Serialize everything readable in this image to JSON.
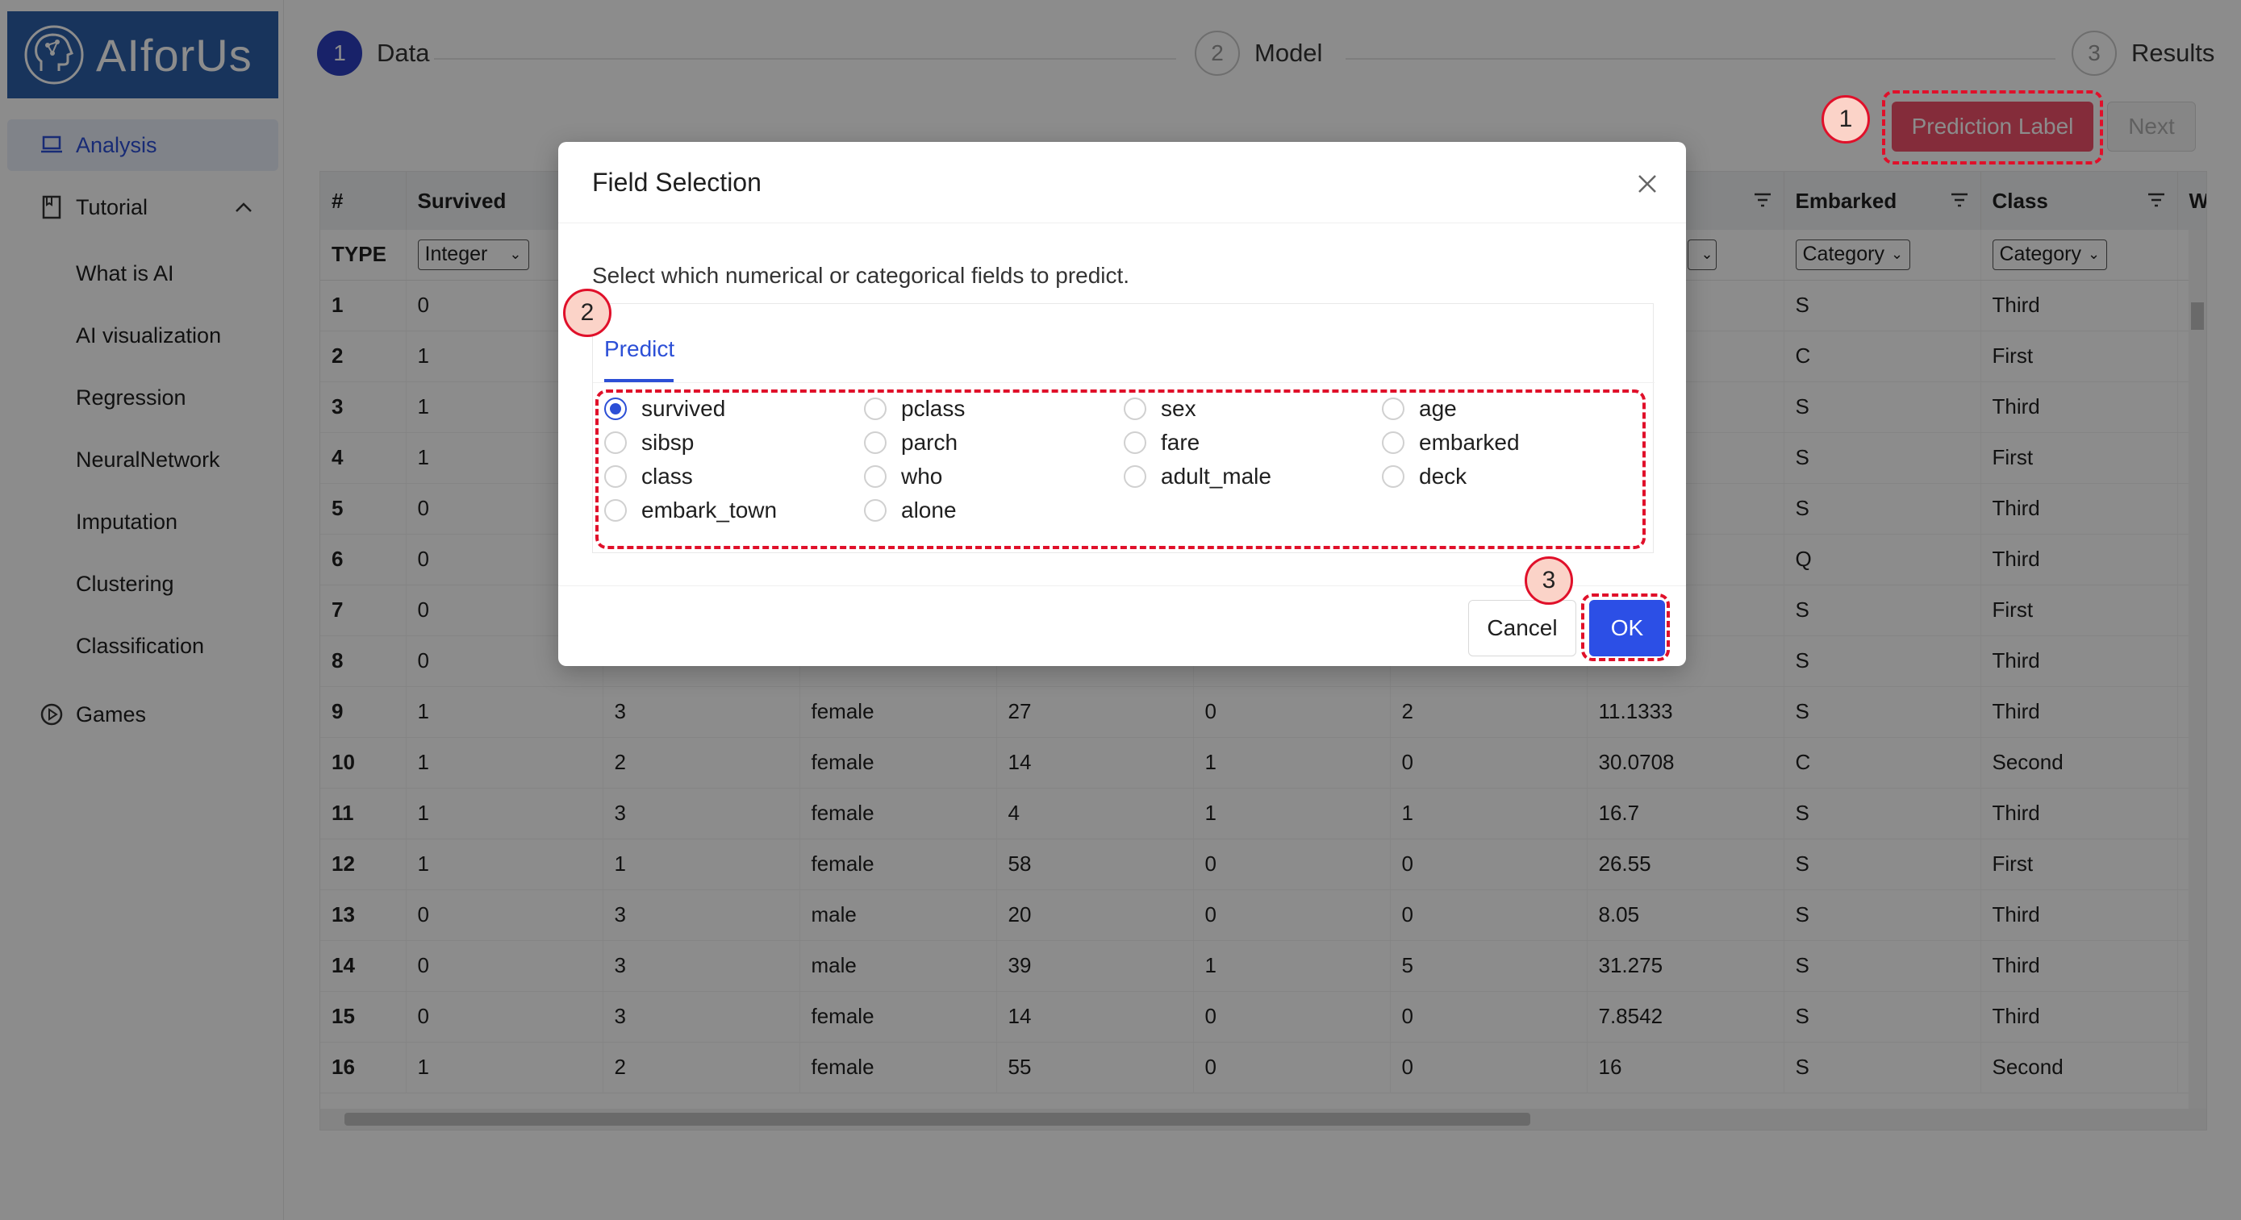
{
  "app": {
    "logo_text": "AIforUs"
  },
  "sidebar": {
    "analysis": "Analysis",
    "tutorial": "Tutorial",
    "tutorial_items": [
      "What is AI",
      "AI visualization",
      "Regression",
      "NeuralNetwork",
      "Imputation",
      "Clustering",
      "Classification"
    ],
    "games": "Games"
  },
  "steps": [
    {
      "num": "1",
      "label": "Data"
    },
    {
      "num": "2",
      "label": "Model"
    },
    {
      "num": "3",
      "label": "Results"
    }
  ],
  "toolbar": {
    "prediction_label": "Prediction Label",
    "next": "Next"
  },
  "table": {
    "columns": [
      "#",
      "Survived",
      "",
      "",
      "",
      "",
      "",
      "",
      "Embarked",
      "Class",
      "W"
    ],
    "type_label": "TYPE",
    "types": [
      "Integer",
      "",
      "",
      "",
      "",
      "",
      "",
      "Category",
      "Category"
    ],
    "rows": [
      [
        "1",
        "0",
        "",
        "",
        "",
        "",
        "",
        "",
        "S",
        "Third"
      ],
      [
        "2",
        "1",
        "",
        "",
        "",
        "",
        "",
        "",
        "C",
        "First"
      ],
      [
        "3",
        "1",
        "",
        "",
        "",
        "",
        "",
        "",
        "S",
        "Third"
      ],
      [
        "4",
        "1",
        "",
        "",
        "",
        "",
        "",
        "",
        "S",
        "First"
      ],
      [
        "5",
        "0",
        "",
        "",
        "",
        "",
        "",
        "",
        "S",
        "Third"
      ],
      [
        "6",
        "0",
        "",
        "",
        "",
        "",
        "",
        "",
        "Q",
        "Third"
      ],
      [
        "7",
        "0",
        "",
        "",
        "",
        "",
        "",
        "",
        "S",
        "First"
      ],
      [
        "8",
        "0",
        "",
        "",
        "",
        "",
        "",
        "",
        "S",
        "Third"
      ],
      [
        "9",
        "1",
        "3",
        "female",
        "27",
        "0",
        "2",
        "11.1333",
        "S",
        "Third"
      ],
      [
        "10",
        "1",
        "2",
        "female",
        "14",
        "1",
        "0",
        "30.0708",
        "C",
        "Second"
      ],
      [
        "11",
        "1",
        "3",
        "female",
        "4",
        "1",
        "1",
        "16.7",
        "S",
        "Third"
      ],
      [
        "12",
        "1",
        "1",
        "female",
        "58",
        "0",
        "0",
        "26.55",
        "S",
        "First"
      ],
      [
        "13",
        "0",
        "3",
        "male",
        "20",
        "0",
        "0",
        "8.05",
        "S",
        "Third"
      ],
      [
        "14",
        "0",
        "3",
        "male",
        "39",
        "1",
        "5",
        "31.275",
        "S",
        "Third"
      ],
      [
        "15",
        "0",
        "3",
        "female",
        "14",
        "0",
        "0",
        "7.8542",
        "S",
        "Third"
      ],
      [
        "16",
        "1",
        "2",
        "female",
        "55",
        "0",
        "0",
        "16",
        "S",
        "Second"
      ]
    ]
  },
  "modal": {
    "title": "Field Selection",
    "description": "Select which numerical or categorical fields to predict.",
    "tab": "Predict",
    "selected": "survived",
    "fields": [
      "survived",
      "pclass",
      "sex",
      "age",
      "sibsp",
      "parch",
      "fare",
      "embarked",
      "class",
      "who",
      "adult_male",
      "deck",
      "embark_town",
      "alone"
    ],
    "cancel": "Cancel",
    "ok": "OK"
  },
  "annotations": [
    "1",
    "2",
    "3"
  ],
  "colors": {
    "accent": "#2c4fd6",
    "annotation": "#e0102a",
    "logo_bg": "#2d5fa8"
  }
}
